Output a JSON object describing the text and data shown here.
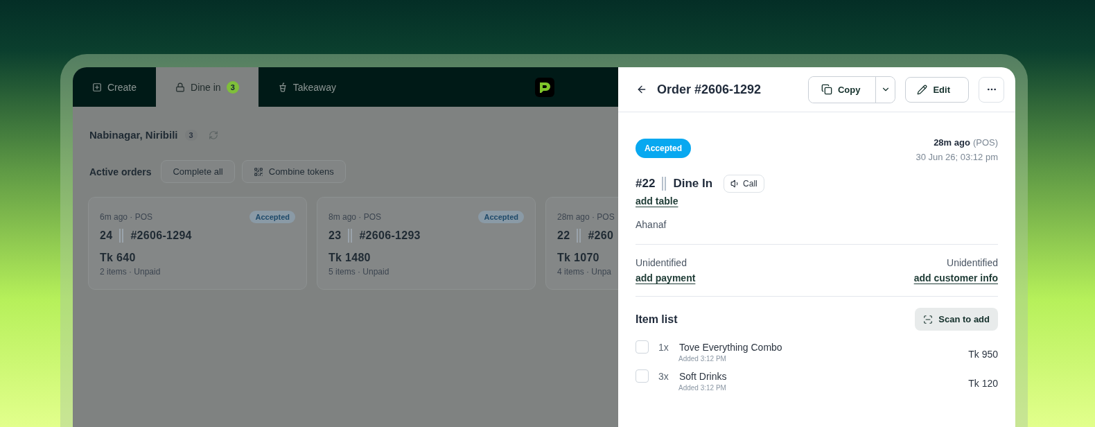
{
  "tabs": [
    {
      "label": "Create",
      "selected": false
    },
    {
      "label": "Dine in",
      "selected": true,
      "badge": "3"
    },
    {
      "label": "Takeaway",
      "selected": false
    }
  ],
  "location": {
    "name": "Nabinagar, Niribili",
    "count": "3"
  },
  "active_orders": {
    "label": "Active orders",
    "buttons": [
      "Complete all",
      "Combine tokens"
    ]
  },
  "cards": [
    {
      "meta": "6m ago · POS",
      "status": "Accepted",
      "token": "24",
      "order_no": "#2606-1294",
      "total": "Tk 640",
      "summary": "2 items · Unpaid"
    },
    {
      "meta": "8m ago · POS",
      "status": "Accepted",
      "token": "23",
      "order_no": "#2606-1293",
      "total": "Tk 1480",
      "summary": "5 items · Unpaid"
    },
    {
      "meta": "28m ago · POS",
      "token": "22",
      "order_no": "#260",
      "total": "Tk 1070",
      "summary": "4 items · Unpa"
    }
  ],
  "order": {
    "title": "Order #2606-1292",
    "copy": "Copy",
    "edit": "Edit",
    "status": "Accepted",
    "time_ago": "28m ago",
    "source": "(POS)",
    "date": "30 Jun 26; 03:12 pm",
    "token": "#22",
    "type": "Dine In",
    "call": "Call",
    "add_table": "add table",
    "customer_name": "Ahanaf",
    "payment": {
      "status": "Unidentified",
      "link": "add payment"
    },
    "customer": {
      "status": "Unidentified",
      "link": "add customer info"
    },
    "item_list": {
      "title": "Item list",
      "scan": "Scan to add",
      "items": [
        {
          "qty": "1x",
          "name": "Tove Everything Combo",
          "added": "Added 3:12 PM",
          "price": "Tk 950",
          "checked": false
        },
        {
          "qty": "3x",
          "name": "Soft Drinks",
          "added": "Added 3:12 PM",
          "price": "Tk 120",
          "checked": false
        }
      ]
    }
  }
}
